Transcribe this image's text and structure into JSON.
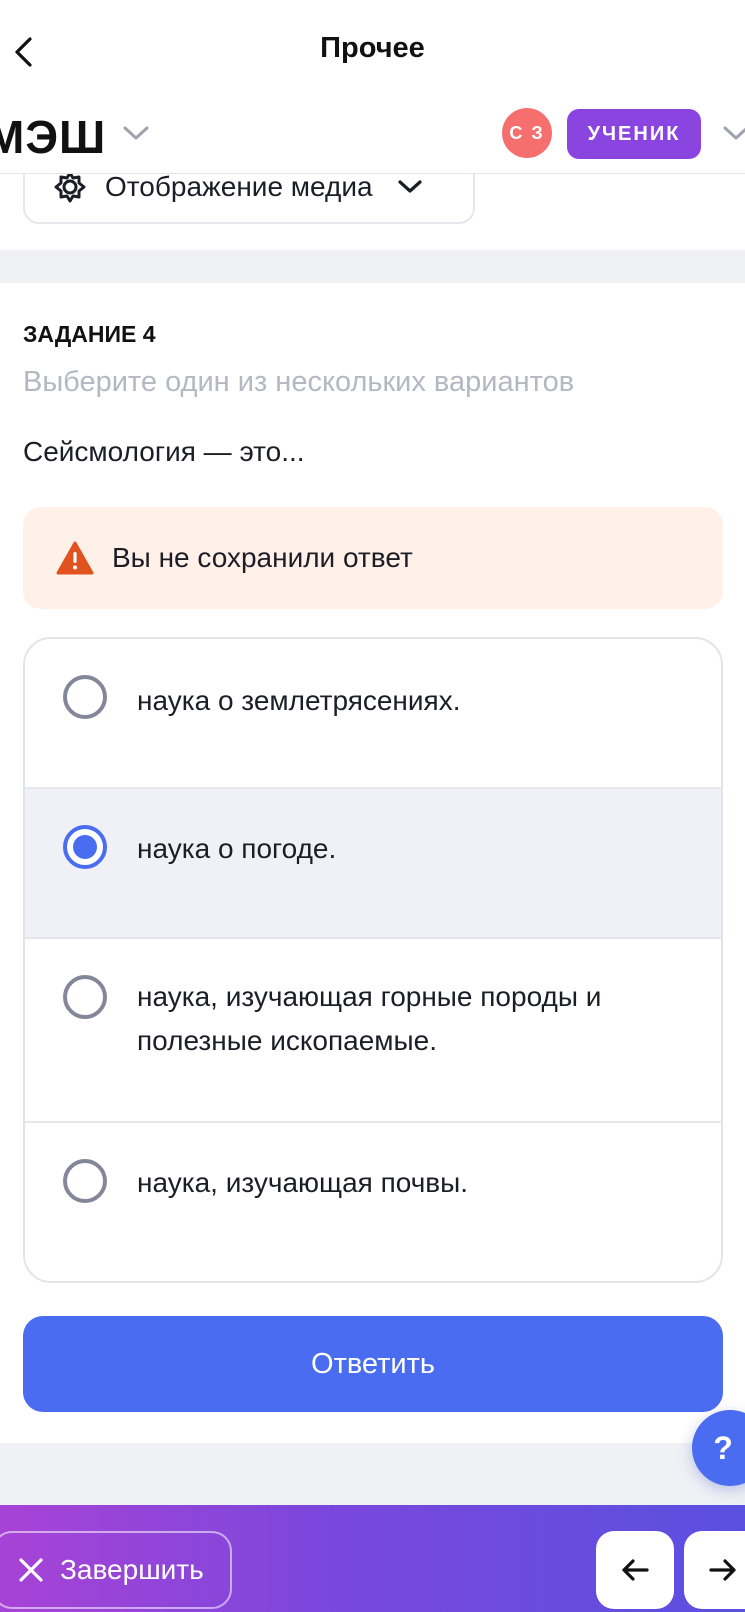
{
  "nav": {
    "title": "Прочее",
    "back_icon": "chevron-left-icon"
  },
  "appbar": {
    "logo": "МЭШ",
    "avatar_initials": "С З",
    "role": "УЧЕНИК",
    "colors": {
      "avatar": "#f56f6f",
      "role_badge": "#8a44e0"
    }
  },
  "media": {
    "label": "Отображение медиа",
    "icon": "gear-icon"
  },
  "task": {
    "number": "ЗАДАНИЕ 4",
    "hint": "Выберите один из нескольких вариантов",
    "question": "Сейсмология — это...",
    "warning": "Вы не сохранили ответ",
    "options": [
      {
        "text": "наука о землетрясениях.",
        "selected": false
      },
      {
        "text": "наука о погоде.",
        "selected": true
      },
      {
        "text": "наука, изучающая горные породы и полезные ископаемые.",
        "selected": false
      },
      {
        "text": "наука, изучающая почвы.",
        "selected": false
      }
    ],
    "answer_label": "Ответить"
  },
  "help": {
    "label": "?"
  },
  "bottom": {
    "finish_label": "Завершить",
    "prev_icon": "arrow-left-icon",
    "next_icon": "arrow-right-icon"
  },
  "colors": {
    "accent": "#4a6cf0",
    "warning_bg": "#fff1e8",
    "warning_icon": "#e0531f"
  }
}
